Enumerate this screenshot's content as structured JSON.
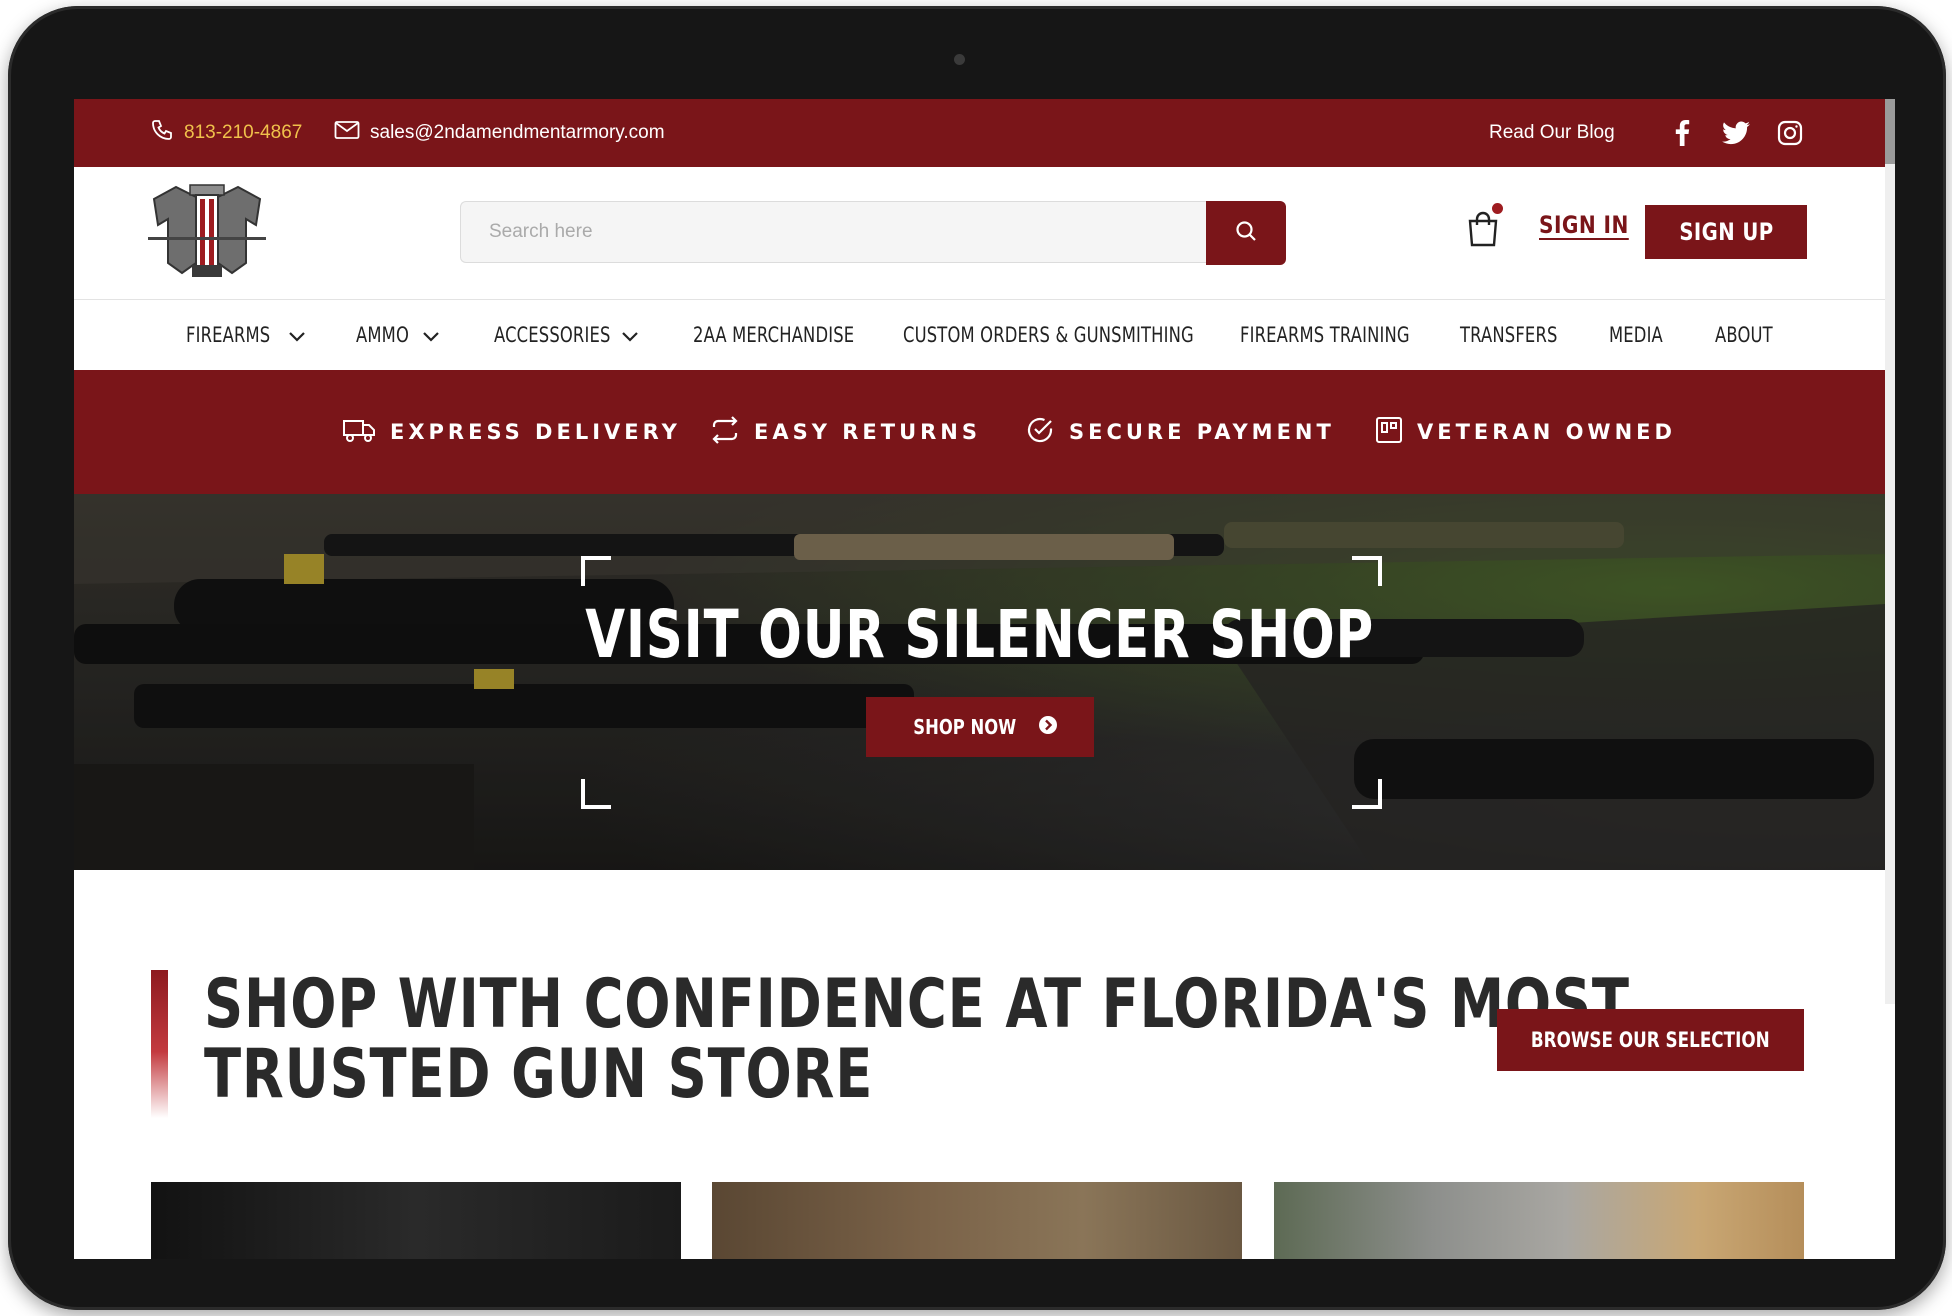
{
  "colors": {
    "brand": "#7a1519",
    "phone": "#f0c14b",
    "text": "#2a2a2a"
  },
  "topbar": {
    "phone": "813-210-4867",
    "email": "sales@2ndamendmentarmory.com",
    "blog_label": "Read Our Blog",
    "social": [
      "facebook-icon",
      "twitter-icon",
      "instagram-icon"
    ]
  },
  "header": {
    "search_placeholder": "Search here",
    "sign_in": "SIGN IN",
    "sign_up": "SIGN UP"
  },
  "nav": {
    "items": [
      {
        "label": "FIREARMS",
        "dropdown": true
      },
      {
        "label": "AMMO",
        "dropdown": true
      },
      {
        "label": "ACCESSORIES",
        "dropdown": true
      },
      {
        "label": "2AA MERCHANDISE",
        "dropdown": false
      },
      {
        "label": "CUSTOM ORDERS & GUNSMITHING",
        "dropdown": false
      },
      {
        "label": "FIREARMS TRAINING",
        "dropdown": false
      },
      {
        "label": "TRANSFERS",
        "dropdown": false
      },
      {
        "label": "MEDIA",
        "dropdown": false
      },
      {
        "label": "ABOUT",
        "dropdown": false
      }
    ]
  },
  "features": [
    {
      "label": "EXPRESS DELIVERY",
      "icon": "truck-icon"
    },
    {
      "label": "EASY RETURNS",
      "icon": "returns-icon"
    },
    {
      "label": "SECURE PAYMENT",
      "icon": "check-circle-icon"
    },
    {
      "label": "VETERAN OWNED",
      "icon": "badge-icon"
    }
  ],
  "hero": {
    "title": "VISIT OUR SILENCER SHOP",
    "button": "SHOP NOW"
  },
  "confidence": {
    "title_line1": "SHOP WITH CONFIDENCE AT FLORIDA'S MOST",
    "title_line2": "TRUSTED GUN STORE",
    "button": "BROWSE OUR SELECTION"
  }
}
